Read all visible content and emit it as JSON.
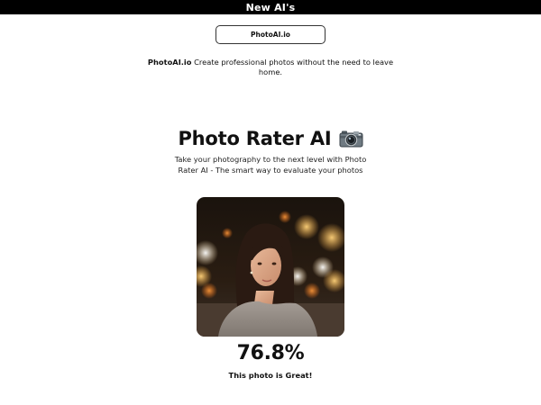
{
  "header": {
    "title": "New AI's"
  },
  "ad": {
    "button_label": "PhotoAI.io",
    "brand": "PhotoAI.io",
    "description": " Create professional photos without the need to leave home."
  },
  "hero": {
    "title": "Photo Rater AI",
    "icon": "camera-icon",
    "subtitle": "Take your photography to the next level with Photo Rater AI - The smart way to evaluate your photos"
  },
  "result": {
    "image": "sample-photo",
    "score": "76.8%",
    "verdict": "This photo is Great!"
  }
}
